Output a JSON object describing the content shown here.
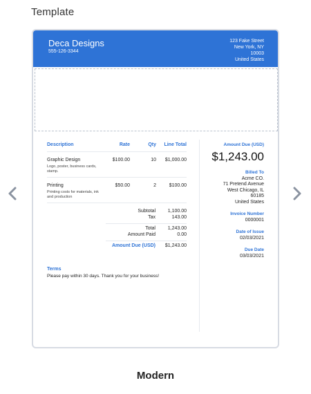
{
  "page": {
    "section_title": "Template",
    "footer_title": "Modern"
  },
  "colors": {
    "accent": "#2e73d6",
    "header_text": "#ffffff",
    "border": "#d7dbe3"
  },
  "icons": {
    "prev": "chevron-left-icon",
    "next": "chevron-right-icon"
  },
  "invoice": {
    "company": {
      "name": "Deca Designs",
      "phone": "555-126-3344",
      "address": [
        "123 Fake Street",
        "New York, NY",
        "10003",
        "United States"
      ]
    },
    "table": {
      "headers": [
        "Description",
        "Rate",
        "Qty",
        "Line Total"
      ],
      "items": [
        {
          "name": "Graphic Design",
          "note": "Logo, poster, business cards, stamp.",
          "rate": "$100.00",
          "qty": "10",
          "total": "$1,000.00"
        },
        {
          "name": "Printing",
          "note": "Printing costs for materials, ink and production",
          "rate": "$50.00",
          "qty": "2",
          "total": "$100.00"
        }
      ]
    },
    "totals": {
      "subtotal_label": "Subtotal",
      "subtotal": "1,100.00",
      "tax_label": "Tax",
      "tax": "143.00",
      "total_label": "Total",
      "total": "1,243.00",
      "paid_label": "Amount Paid",
      "paid": "0.00",
      "due_label": "Amount Due (USD)",
      "due": "$1,243.00"
    },
    "terms": {
      "title": "Terms",
      "text": "Please pay within 30 days. Thank you for your business!"
    },
    "side": {
      "amount_due_label": "Amount Due (USD)",
      "amount_due": "$1,243.00",
      "billed_to_label": "Billed To",
      "billed_to": [
        "Acme CO.",
        "71 Pretend Avenue",
        "West Chicago, IL",
        "60185",
        "United States"
      ],
      "invoice_number_label": "Invoice Number",
      "invoice_number": "0000001",
      "issue_label": "Date of Issue",
      "issue_date": "02/03/2021",
      "due_date_label": "Due Date",
      "due_date": "03/03/2021"
    }
  }
}
